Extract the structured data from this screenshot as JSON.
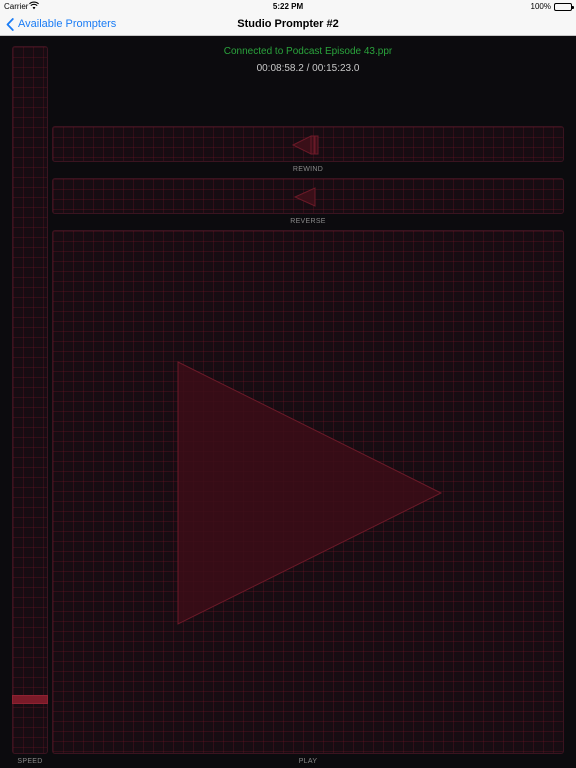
{
  "status_bar": {
    "carrier": "Carrier",
    "time": "5:22 PM",
    "battery": "100%"
  },
  "nav": {
    "back_label": "Available Prompters",
    "title": "Studio Prompter #2"
  },
  "main": {
    "connection_status": "Connected to Podcast Episode 43.ppr",
    "time_readout": "00:08:58.2 / 00:15:23.0",
    "controls": {
      "rewind_label": "REWIND",
      "reverse_label": "REVERSE",
      "play_label": "PLAY",
      "speed_label": "SPEED"
    },
    "speed_level": 0.07
  },
  "colors": {
    "accent_blue": "#1a7cf5",
    "connected_green": "#2aa33c",
    "control_red": "#7a1a28"
  },
  "icons": {
    "back": "chevron-left-icon",
    "wifi": "wifi-icon",
    "battery": "battery-icon",
    "rewind": "rewind-icon",
    "reverse": "reverse-icon",
    "play": "play-icon"
  }
}
